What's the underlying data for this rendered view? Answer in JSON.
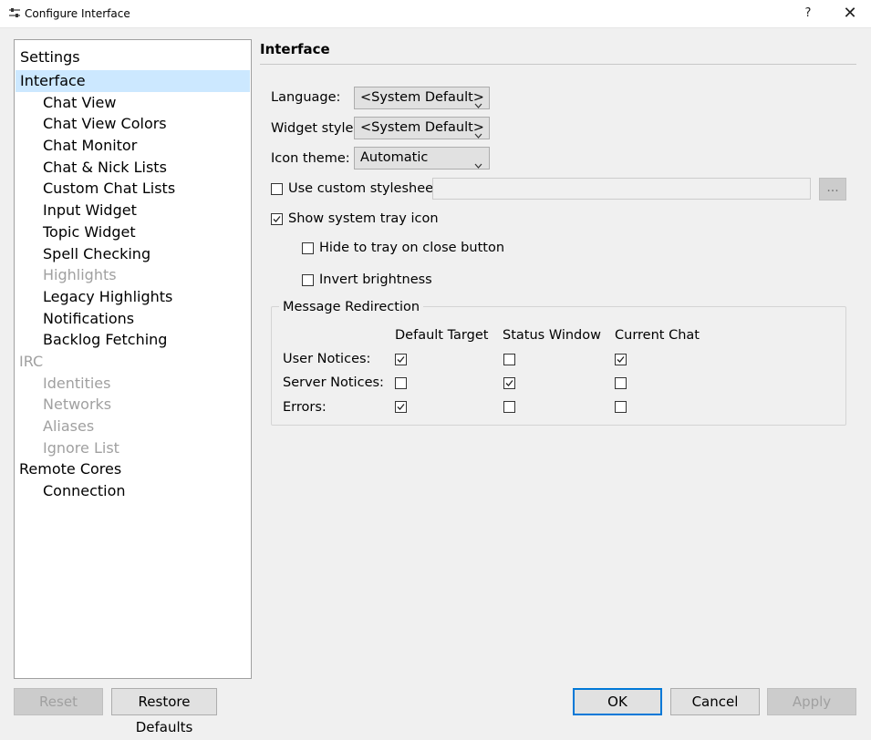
{
  "window": {
    "title": "Configure Interface",
    "help_label": "?",
    "close_label": "✕"
  },
  "sidebar": {
    "header": "Settings",
    "items": [
      {
        "label": "Interface",
        "level": 0,
        "state": "selected"
      },
      {
        "label": "Chat View",
        "level": 1,
        "state": "enabled"
      },
      {
        "label": "Chat View Colors",
        "level": 1,
        "state": "enabled"
      },
      {
        "label": "Chat Monitor",
        "level": 1,
        "state": "enabled"
      },
      {
        "label": "Chat & Nick Lists",
        "level": 1,
        "state": "enabled"
      },
      {
        "label": "Custom Chat Lists",
        "level": 1,
        "state": "enabled"
      },
      {
        "label": "Input Widget",
        "level": 1,
        "state": "enabled"
      },
      {
        "label": "Topic Widget",
        "level": 1,
        "state": "enabled"
      },
      {
        "label": "Spell Checking",
        "level": 1,
        "state": "enabled"
      },
      {
        "label": "Highlights",
        "level": 1,
        "state": "disabled"
      },
      {
        "label": "Legacy Highlights",
        "level": 1,
        "state": "enabled"
      },
      {
        "label": "Notifications",
        "level": 1,
        "state": "enabled"
      },
      {
        "label": "Backlog Fetching",
        "level": 1,
        "state": "enabled"
      },
      {
        "label": "IRC",
        "level": 0,
        "state": "disabled"
      },
      {
        "label": "Identities",
        "level": 1,
        "state": "disabled"
      },
      {
        "label": "Networks",
        "level": 1,
        "state": "disabled"
      },
      {
        "label": "Aliases",
        "level": 1,
        "state": "disabled"
      },
      {
        "label": "Ignore List",
        "level": 1,
        "state": "disabled"
      },
      {
        "label": "Remote Cores",
        "level": 0,
        "state": "enabled"
      },
      {
        "label": "Connection",
        "level": 1,
        "state": "enabled"
      }
    ]
  },
  "page": {
    "title": "Interface",
    "language_label": "Language:",
    "language_value": "<System Default>",
    "widget_style_label": "Widget style:",
    "widget_style_value": "<System Default>",
    "icon_theme_label": "Icon theme:",
    "icon_theme_value": "Automatic",
    "custom_stylesheet_label": "Use custom stylesheet",
    "custom_stylesheet_checked": false,
    "stylesheet_path": "",
    "browse_label": "...",
    "tray_icon_label": "Show system tray icon",
    "tray_icon_checked": true,
    "hide_to_tray_label": "Hide to tray on close button",
    "hide_to_tray_checked": false,
    "invert_brightness_label": "Invert brightness",
    "invert_brightness_checked": false
  },
  "redirection": {
    "title": "Message Redirection",
    "columns": [
      "Default Target",
      "Status Window",
      "Current Chat"
    ],
    "rows": [
      {
        "label": "User Notices:",
        "values": [
          true,
          false,
          true
        ]
      },
      {
        "label": "Server Notices:",
        "values": [
          false,
          true,
          false
        ]
      },
      {
        "label": "Errors:",
        "values": [
          true,
          false,
          false
        ]
      }
    ]
  },
  "buttons": {
    "reset": "Reset",
    "restore_defaults": "Restore Defaults",
    "ok": "OK",
    "cancel": "Cancel",
    "apply": "Apply"
  },
  "colors": {
    "selection": "#cce8ff",
    "default_button_border": "#0078d7",
    "disabled_text": "#a0a0a0"
  }
}
